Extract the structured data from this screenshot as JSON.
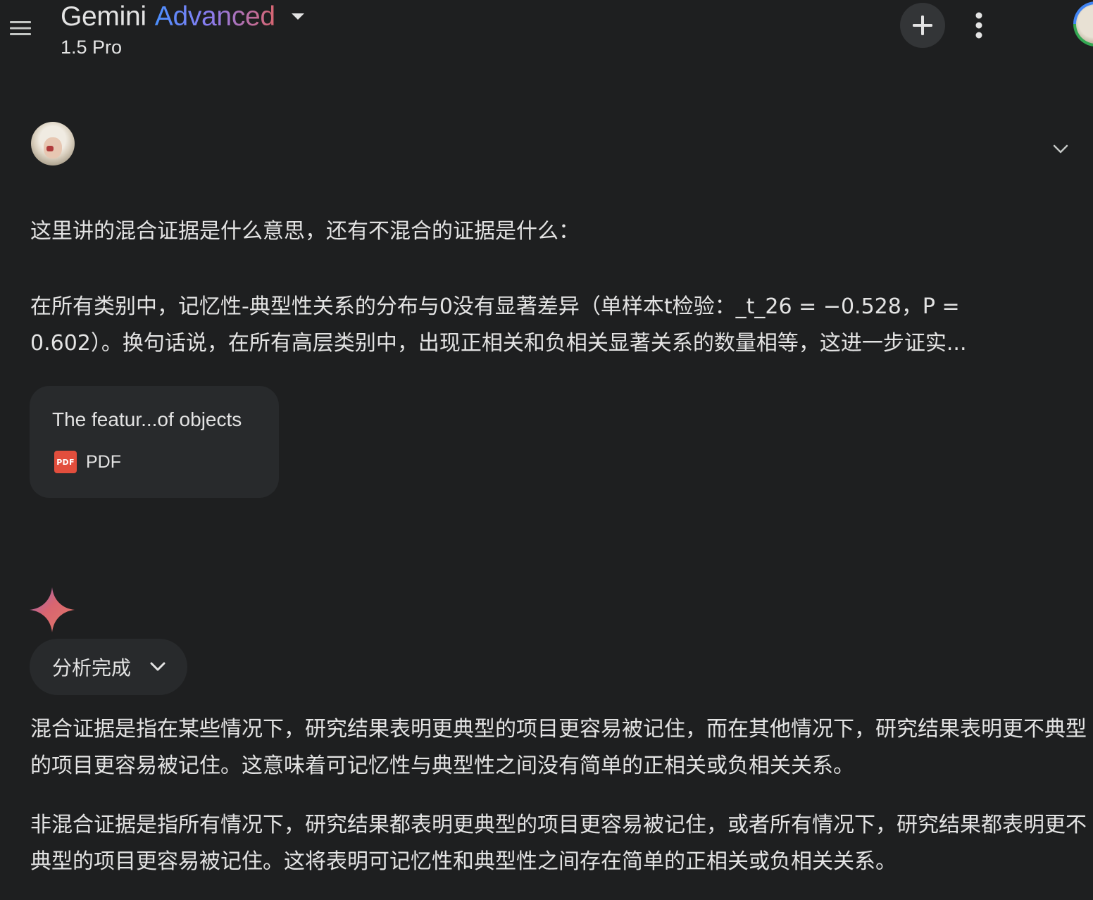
{
  "header": {
    "title_main": "Gemini",
    "title_accent": "Advanced",
    "model_version": "1.5 Pro",
    "menu_icon": "hamburger-menu-icon",
    "caret_icon": "caret-down-icon",
    "new_chat_icon": "plus-icon",
    "more_icon": "more-vert-icon",
    "accent_gradient": [
      "#4b90ff",
      "#8a7cf0",
      "#d96570"
    ]
  },
  "user_message": {
    "query": "这里讲的混合证据是什么意思，还有不混合的证据是什么：",
    "quoted_text": "在所有类别中，记忆性-典型性关系的分布与0没有显著差异（单样本t检验：_t_26 = −0.528，P = 0.602）。换句话说，在所有高层类别中，出现正相关和负相关显著关系的数量相等，这进一步证实...",
    "expand_icon": "chevron-down-icon",
    "attachment": {
      "name": "The featur...of objects",
      "type": "PDF",
      "icon_label": "PDF",
      "icon_color": "#e24e3d"
    }
  },
  "response": {
    "spark_icon": "gemini-spark-icon",
    "analysis_chip_label": "分析完成",
    "paragraphs": [
      "混合证据是指在某些情况下，研究结果表明更典型的项目更容易被记住，而在其他情况下，研究结果表明更不典型的项目更容易被记住。这意味着可记忆性与典型性之间没有简单的正相关或负相关关系。",
      "非混合证据是指所有情况下，研究结果都表明更典型的项目更容易被记住，或者所有情况下，研究结果都表明更不典型的项目更容易被记住。这将表明可记忆性和典型性之间存在简单的正相关或负相关关系。"
    ]
  },
  "colors": {
    "background": "#1e1f20",
    "surface": "#282a2c",
    "button_bg": "#333537",
    "text": "#e3e3e3"
  }
}
